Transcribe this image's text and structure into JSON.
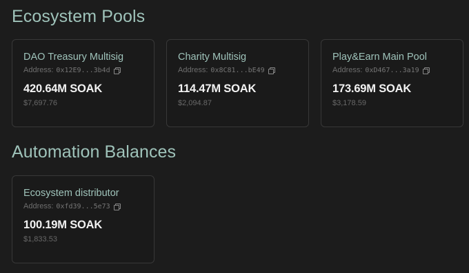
{
  "sections": {
    "pools_title": "Ecosystem Pools",
    "automation_title": "Automation Balances"
  },
  "address_label": "Address:",
  "pools": [
    {
      "name": "DAO Treasury Multisig",
      "address": "0x12E9...3b4d",
      "amount": "420.64M SOAK",
      "usd": "$7,697.76"
    },
    {
      "name": "Charity Multisig",
      "address": "0x8C81...bE49",
      "amount": "114.47M SOAK",
      "usd": "$2,094.87"
    },
    {
      "name": "Play&Earn Main Pool",
      "address": "0xD467...3a19",
      "amount": "173.69M SOAK",
      "usd": "$3,178.59"
    }
  ],
  "automation": [
    {
      "name": "Ecosystem distributor",
      "address": "0xfd39...5e73",
      "amount": "100.19M SOAK",
      "usd": "$1,833.53"
    }
  ],
  "colors": {
    "background": "#1c1c1c",
    "accent": "#9fc3ba",
    "card_border": "#383838"
  },
  "icons": {
    "copy": "copy-icon"
  }
}
